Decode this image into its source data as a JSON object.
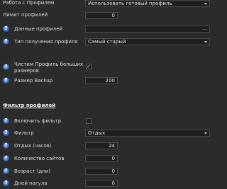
{
  "settings": {
    "work_with_profile": {
      "label": "Работа с Профилем",
      "value": "Использовать готовый профиль"
    },
    "profile_limit": {
      "label": "Лимит профилей",
      "value": "0"
    },
    "profile_data": {
      "label": "Данные профилей",
      "value": ""
    },
    "profile_get_type": {
      "label": "Тип получения профиля",
      "value": "Самый старый"
    },
    "clean_large_profiles": {
      "label_line1": "Чистим Профиль больших",
      "label_line2": "размеров",
      "checked": "✓"
    },
    "backup_size": {
      "label": "Размер Backup",
      "value": "200"
    }
  },
  "filter": {
    "section_title": "Фильтр профилей",
    "enable_filter": {
      "label": "Включить фильтр",
      "checked": ""
    },
    "filter_type": {
      "label": "Фильтр",
      "value": "Отдых"
    },
    "rest_hours": {
      "label": "Отдых (часов)",
      "value": "24"
    },
    "sites_count": {
      "label": "Количество сайтов",
      "value": "0"
    },
    "age_days": {
      "label": "Возраст (дни)",
      "value": "0"
    },
    "days_away": {
      "label": "Дней нагула",
      "value": "0"
    }
  },
  "icons": {
    "help": "question-mark-circle-icon",
    "dropdown": "chevron-down-icon",
    "browse": "ellipsis-icon"
  },
  "colors": {
    "background": "#2b2b2b",
    "field": "#1f1f1f",
    "help_icon": "#3d78c8"
  }
}
